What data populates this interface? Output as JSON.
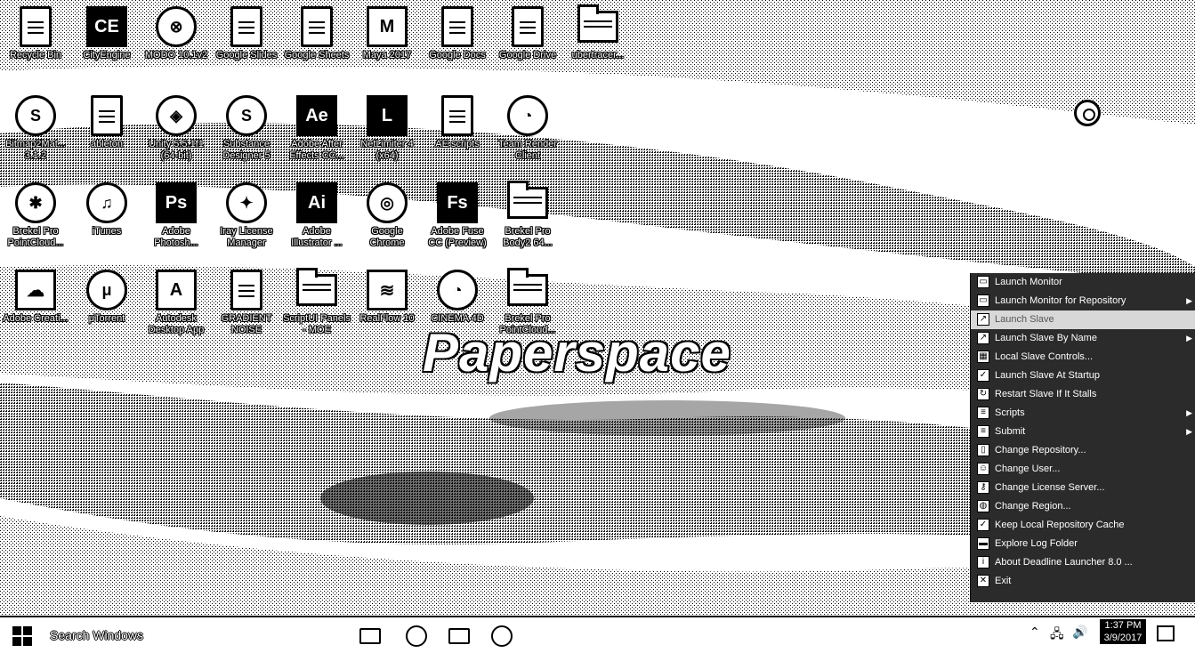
{
  "desktop": {
    "icons": [
      {
        "label": "Recycle Bin",
        "glyph": "recycle-bin-icon",
        "abbr": "♻"
      },
      {
        "label": "CityEngine",
        "glyph": "cityengine-icon",
        "abbr": "CE"
      },
      {
        "label": "MODO 10.1v2",
        "glyph": "modo-icon",
        "abbr": "⊗"
      },
      {
        "label": "Google Slides",
        "glyph": "google-slides-icon",
        "abbr": ""
      },
      {
        "label": "Google Sheets",
        "glyph": "google-sheets-icon",
        "abbr": ""
      },
      {
        "label": "Maya 2017",
        "glyph": "maya-icon",
        "abbr": "M"
      },
      {
        "label": "Google Docs",
        "glyph": "google-docs-icon",
        "abbr": ""
      },
      {
        "label": "Google Drive",
        "glyph": "google-drive-icon",
        "abbr": ""
      },
      {
        "label": "ubertracer...",
        "glyph": "archive-icon",
        "abbr": ""
      },
      {
        "label": "Bitmap2Mat... 3.1.2",
        "glyph": "bitmap2material-icon",
        "abbr": "S"
      },
      {
        "label": "ableton",
        "glyph": "ableton-file-icon",
        "abbr": ""
      },
      {
        "label": "Unity 5.5.1f1 (64-bit)",
        "glyph": "unity-icon",
        "abbr": "◈"
      },
      {
        "label": "Substance Designer 5",
        "glyph": "substance-designer-icon",
        "abbr": "S"
      },
      {
        "label": "Adobe After Effects CC...",
        "glyph": "after-effects-icon",
        "abbr": "Ae"
      },
      {
        "label": "NetLimiter 4 (x64)",
        "glyph": "netlimiter-icon",
        "abbr": "L"
      },
      {
        "label": "AE scripts",
        "glyph": "ae-scripts-file-icon",
        "abbr": ""
      },
      {
        "label": "Team Render Client",
        "glyph": "team-render-icon",
        "abbr": "◔"
      },
      {
        "label": "Brekel Pro PointCloud...",
        "glyph": "brekel-pointcloud-icon",
        "abbr": "✱"
      },
      {
        "label": "iTunes",
        "glyph": "itunes-icon",
        "abbr": "♫"
      },
      {
        "label": "Adobe Photosh...",
        "glyph": "photoshop-icon",
        "abbr": "Ps"
      },
      {
        "label": "Iray License Manager",
        "glyph": "iray-icon",
        "abbr": "✦"
      },
      {
        "label": "Adobe Illustrator ...",
        "glyph": "illustrator-icon",
        "abbr": "Ai"
      },
      {
        "label": "Google Chrome",
        "glyph": "chrome-icon",
        "abbr": "◎"
      },
      {
        "label": "Adobe Fuse CC (Preview)",
        "glyph": "fuse-icon",
        "abbr": "Fs"
      },
      {
        "label": "Brekel Pro Body2 64...",
        "glyph": "archive-icon",
        "abbr": ""
      },
      {
        "label": "Adobe Creati...",
        "glyph": "creative-cloud-icon",
        "abbr": "☁"
      },
      {
        "label": "μTorrent",
        "glyph": "utorrent-icon",
        "abbr": "μ"
      },
      {
        "label": "Autodesk Desktop App",
        "glyph": "autodesk-icon",
        "abbr": "A"
      },
      {
        "label": "GRADIENT NOISE",
        "glyph": "noise-file-icon",
        "abbr": ""
      },
      {
        "label": "ScriptUI Panels - MOE",
        "glyph": "archive-icon",
        "abbr": ""
      },
      {
        "label": "RealFlow 10",
        "glyph": "realflow-icon",
        "abbr": "≋"
      },
      {
        "label": "CINEMA 4D",
        "glyph": "cinema4d-icon",
        "abbr": "◔"
      },
      {
        "label": "Brekel Pro PointCloud...",
        "glyph": "archive-icon",
        "abbr": ""
      }
    ],
    "watermark": "Paperspace"
  },
  "context_menu": {
    "items": [
      {
        "label": "Launch Monitor",
        "icon": "monitor-icon",
        "submenu": false,
        "highlight": false
      },
      {
        "label": "Launch Monitor for Repository",
        "icon": "monitor-icon",
        "submenu": true,
        "highlight": false
      },
      {
        "label": "Launch Slave",
        "icon": "slave-icon",
        "submenu": false,
        "highlight": true
      },
      {
        "label": "Launch Slave By Name",
        "icon": "slave-icon",
        "submenu": true,
        "highlight": false
      },
      {
        "label": "Local Slave Controls...",
        "icon": "controls-icon",
        "submenu": false,
        "highlight": false
      },
      {
        "label": "Launch Slave At Startup",
        "icon": "checkbox-icon",
        "submenu": false,
        "highlight": false
      },
      {
        "label": "Restart Slave If It Stalls",
        "icon": "restart-icon",
        "submenu": false,
        "highlight": false
      },
      {
        "label": "Scripts",
        "icon": "script-icon",
        "submenu": true,
        "highlight": false
      },
      {
        "label": "Submit",
        "icon": "submit-icon",
        "submenu": true,
        "highlight": false
      },
      {
        "label": "Change Repository...",
        "icon": "repository-icon",
        "submenu": false,
        "highlight": false
      },
      {
        "label": "Change User...",
        "icon": "user-icon",
        "submenu": false,
        "highlight": false
      },
      {
        "label": "Change License Server...",
        "icon": "key-icon",
        "submenu": false,
        "highlight": false
      },
      {
        "label": "Change Region...",
        "icon": "globe-icon",
        "submenu": false,
        "highlight": false
      },
      {
        "label": "Keep Local Repository Cache",
        "icon": "checkbox-icon",
        "submenu": false,
        "highlight": false
      },
      {
        "label": "Explore Log Folder",
        "icon": "folder-icon",
        "submenu": false,
        "highlight": false
      },
      {
        "label": "About Deadline Launcher 8.0 ...",
        "icon": "info-icon",
        "submenu": false,
        "highlight": false
      },
      {
        "label": "Exit",
        "icon": "close-icon",
        "submenu": false,
        "highlight": false
      }
    ]
  },
  "taskbar": {
    "search_placeholder": "Search Windows",
    "clock_time": "1:37 PM",
    "clock_date": "3/9/2017"
  }
}
